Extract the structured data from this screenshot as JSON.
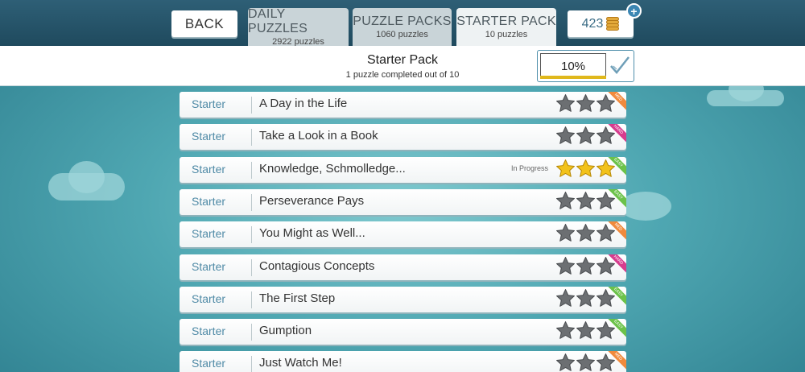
{
  "nav": {
    "back_label": "BACK",
    "tabs": [
      {
        "title": "DAILY PUZZLES",
        "subtitle": "2922 puzzles"
      },
      {
        "title": "PUZZLE PACKS",
        "subtitle": "1060 puzzles"
      },
      {
        "title": "STARTER PACK",
        "subtitle": "10 puzzles"
      }
    ],
    "coins": "423",
    "add_icon": "plus-icon"
  },
  "header": {
    "title": "Starter Pack",
    "subtitle": "1  puzzle completed out of 10",
    "progress_label": "10%",
    "progress_fraction": 0.1
  },
  "colors": {
    "accent": "#3b86b3",
    "star_gold": "#f2c21a",
    "star_gray": "#6c6f72",
    "ribbon_easy": "#6cc24a",
    "ribbon_med": "#f08a3c",
    "ribbon_hard": "#d63c8e"
  },
  "puzzles": [
    {
      "category": "Starter",
      "name": "A Day in the Life",
      "status": "",
      "stars": 0,
      "difficulty": "MED"
    },
    {
      "category": "Starter",
      "name": "Take a Look in a Book",
      "status": "",
      "stars": 0,
      "difficulty": "HARD"
    },
    {
      "category": "Starter",
      "name": "Knowledge, Schmolledge...",
      "status": "In Progress",
      "stars": 3,
      "difficulty": "EASY"
    },
    {
      "category": "Starter",
      "name": "Perseverance Pays",
      "status": "",
      "stars": 0,
      "difficulty": "EASY"
    },
    {
      "category": "Starter",
      "name": "You Might as Well...",
      "status": "",
      "stars": 0,
      "difficulty": "MED"
    },
    {
      "category": "Starter",
      "name": "Contagious Concepts",
      "status": "",
      "stars": 0,
      "difficulty": "HARD"
    },
    {
      "category": "Starter",
      "name": "The First Step",
      "status": "",
      "stars": 0,
      "difficulty": "EASY"
    },
    {
      "category": "Starter",
      "name": "Gumption",
      "status": "",
      "stars": 0,
      "difficulty": "EASY"
    },
    {
      "category": "Starter",
      "name": "Just Watch Me!",
      "status": "",
      "stars": 0,
      "difficulty": "MED"
    }
  ]
}
